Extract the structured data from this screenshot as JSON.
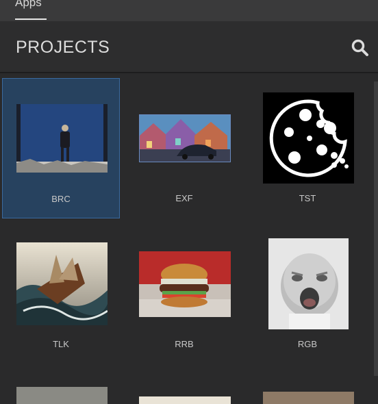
{
  "topbar": {
    "tab_label": "Apps"
  },
  "header": {
    "title": "PROJECTS",
    "search_icon": "search-icon"
  },
  "projects": [
    {
      "label": "BRC"
    },
    {
      "label": "EXF"
    },
    {
      "label": "TST"
    },
    {
      "label": "TLK"
    },
    {
      "label": "RRB"
    },
    {
      "label": "RGB"
    }
  ],
  "colors": {
    "background": "#2b2b2c",
    "selected": "#27425f",
    "selected_border": "#3a6aa0"
  }
}
